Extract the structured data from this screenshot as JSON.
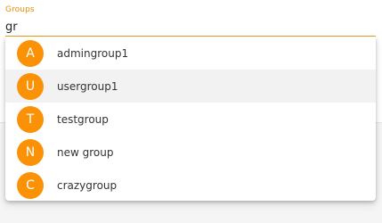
{
  "field": {
    "label": "Groups",
    "value": "gr"
  },
  "colors": {
    "accent": "#ef8c00",
    "avatar": "#fb9205"
  },
  "options": [
    {
      "initial": "A",
      "label": "admingroup1",
      "highlighted": false
    },
    {
      "initial": "U",
      "label": "usergroup1",
      "highlighted": true
    },
    {
      "initial": "T",
      "label": "testgroup",
      "highlighted": false
    },
    {
      "initial": "N",
      "label": "new group",
      "highlighted": false
    },
    {
      "initial": "C",
      "label": "crazygroup",
      "highlighted": false
    }
  ]
}
